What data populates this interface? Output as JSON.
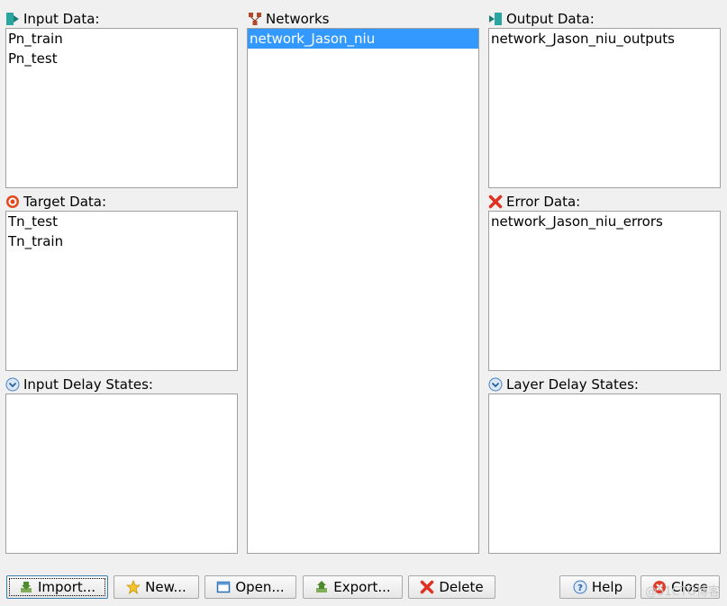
{
  "panels": {
    "input_data": {
      "label": "Input Data:",
      "items": [
        "Pn_train",
        "Pn_test"
      ]
    },
    "target_data": {
      "label": "Target Data:",
      "items": [
        "Tn_test",
        "Tn_train"
      ]
    },
    "input_delay_states": {
      "label": "Input Delay States:",
      "items": []
    },
    "networks": {
      "label": "Networks",
      "items": [
        "network_Jason_niu"
      ],
      "selected_index": 0
    },
    "output_data": {
      "label": "Output Data:",
      "items": [
        "network_Jason_niu_outputs"
      ]
    },
    "error_data": {
      "label": "Error Data:",
      "items": [
        "network_Jason_niu_errors"
      ]
    },
    "layer_delay_states": {
      "label": "Layer Delay States:",
      "items": []
    }
  },
  "buttons": {
    "import": "Import...",
    "new": "New...",
    "open": "Open...",
    "export": "Export...",
    "delete": "Delete",
    "help": "Help",
    "close": "Close"
  },
  "icons": {
    "input": "import-arrow-icon",
    "networks": "network-nodes-icon",
    "output": "export-arrow-icon",
    "target": "target-icon",
    "error": "red-x-icon",
    "delay": "chevron-circle-icon"
  },
  "colors": {
    "selection": "#3399ff",
    "window_bg": "#f0f0f0"
  },
  "watermark": "@51CTO博客"
}
